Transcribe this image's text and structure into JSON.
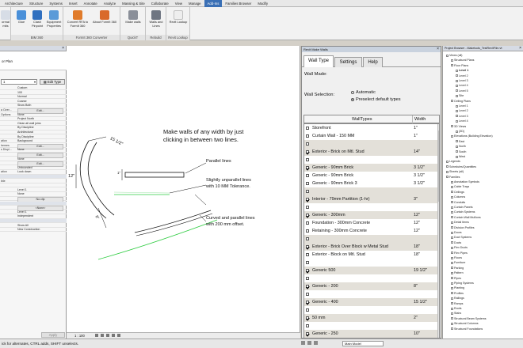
{
  "ribbon": {
    "tabs": [
      "Architecture",
      "Structure",
      "Systems",
      "Insert",
      "Annotate",
      "Analyze",
      "Massing & Site",
      "Collaborate",
      "View",
      "Manage",
      "Add-Ins",
      "Families Browser",
      "Modify"
    ],
    "active_tab": "Add-Ins",
    "groups": [
      {
        "label": "BIM 360",
        "buttons": [
          "Glue",
          "Clash Pinpoint",
          "Equipment Properties"
        ]
      },
      {
        "label": "FormIt 360 Converter",
        "buttons": [
          "Convert RFA to FormIt 360",
          "About FormIt 360"
        ]
      },
      {
        "label": "QuickT",
        "buttons": [
          "Make walls"
        ]
      },
      {
        "label": "Rebuild",
        "buttons": [
          "Walls and Lines"
        ]
      },
      {
        "label": "Revit Lookup",
        "buttons": [
          "Revit Lookup"
        ]
      }
    ],
    "first_button_partial": "ormal mits"
  },
  "properties": {
    "type_name": "or Plan",
    "selector_value": "1",
    "edit_type_label": "Edit Type",
    "rows": [
      {
        "k": "",
        "v": "Custom",
        "kind": "plain"
      },
      {
        "k": "",
        "v": "100",
        "kind": "plain"
      },
      {
        "k": "",
        "v": "Normal",
        "kind": "plain"
      },
      {
        "k": "",
        "v": "Coarse",
        "kind": "plain"
      },
      {
        "k": "",
        "v": "Show Both",
        "kind": "plain"
      },
      {
        "k": "a Over...",
        "v": "Edit...",
        "kind": "btn"
      },
      {
        "k": "Options",
        "v": "None",
        "kind": "plain"
      },
      {
        "k": "",
        "v": "Project North",
        "kind": "plain"
      },
      {
        "k": "",
        "v": "Clean all wall joins",
        "kind": "plain"
      },
      {
        "k": "",
        "v": "By Discipline",
        "kind": "plain"
      },
      {
        "k": "",
        "v": "Architectural",
        "kind": "plain"
      },
      {
        "k": "",
        "v": "By Discipline",
        "kind": "plain"
      },
      {
        "k": "ation",
        "v": "Background",
        "kind": "plain"
      },
      {
        "k": "hemes",
        "v": "Edit...",
        "kind": "btn"
      },
      {
        "k": "s Displ...",
        "v": "None",
        "kind": "plain"
      },
      {
        "k": "",
        "v": "Edit...",
        "kind": "btn"
      },
      {
        "k": "",
        "v": "None",
        "kind": "plain"
      },
      {
        "k": "",
        "v": "Edit...",
        "kind": "btn"
      },
      {
        "k": "",
        "v": "Unbounded",
        "kind": "plain"
      },
      {
        "k": "ation",
        "v": "Look down",
        "kind": "plain"
      },
      {
        "k": "",
        "v": "",
        "kind": "sec"
      },
      {
        "k": "ible",
        "v": "",
        "kind": "plain"
      },
      {
        "k": "",
        "v": "",
        "kind": "plain"
      },
      {
        "k": "",
        "v": "Level 1",
        "kind": "plain"
      },
      {
        "k": "",
        "v": "None",
        "kind": "plain"
      },
      {
        "k": "",
        "v": "No clip",
        "kind": "btn"
      },
      {
        "k": "",
        "v": "",
        "kind": "sec"
      },
      {
        "k": "",
        "v": "<None>",
        "kind": "btn"
      },
      {
        "k": "",
        "v": "Level 1",
        "kind": "plain"
      },
      {
        "k": "",
        "v": "Independent",
        "kind": "plain"
      },
      {
        "k": "",
        "v": "",
        "kind": "sec"
      },
      {
        "k": "",
        "v": "Show All",
        "kind": "plain"
      },
      {
        "k": "",
        "v": "New Construction",
        "kind": "plain"
      }
    ],
    "apply_label": "Apply"
  },
  "canvas": {
    "main_note_line1": "Make walls of any width by just",
    "main_note_line2": "clicking in between two lines.",
    "note_parallel": "Parallel lines",
    "note_unparallel_1": "Slightly unparallel lines",
    "note_unparallel_2": "with 10 MM Tolerance.",
    "note_curved_1": "Curved and parallel lines",
    "note_curved_2": "with 200 mm offset.",
    "dim_1": "15 1/2\"",
    "dim_2": "12\"",
    "dim_3": "8\"",
    "dim_4": "1\"",
    "scale": "1 : 100",
    "plan_model": "Main Model"
  },
  "dialog": {
    "title": "Revit Make Walls",
    "tabs": [
      "Wall Type",
      "Settings",
      "Help"
    ],
    "active_tab": "Wall Type",
    "wall_made_label": "Wall Made:",
    "wall_selection_label": "Wall Selection:",
    "radio_automatic": "Automatic",
    "radio_preselect": "Preselect default types",
    "col_name": "WallTypes",
    "col_width": "Width",
    "rows": [
      {
        "name": "Storefront",
        "width": "1\"",
        "checked": false,
        "band": false
      },
      {
        "name": "Curtain Wall - 150 MM",
        "width": "1\"",
        "checked": false,
        "band": false
      },
      {
        "name": "",
        "width": "",
        "checked": false,
        "band": true
      },
      {
        "name": "Exterior - Brick on Mtl. Stud",
        "width": "14\"",
        "checked": true,
        "band": true
      },
      {
        "name": "",
        "width": "",
        "checked": false,
        "band": false
      },
      {
        "name": "Generic - 90mm Brick",
        "width": "3 1/2\"",
        "checked": true,
        "band": true
      },
      {
        "name": "Generic - 90mm Brick",
        "width": "3 1/2\"",
        "checked": false,
        "band": false
      },
      {
        "name": "Generic - 90mm Brick 3",
        "width": "3 1/2\"",
        "checked": false,
        "band": false
      },
      {
        "name": "",
        "width": "",
        "checked": false,
        "band": true
      },
      {
        "name": "Interior - 79mm Partition (1-hr)",
        "width": "3\"",
        "checked": true,
        "band": true
      },
      {
        "name": "",
        "width": "",
        "checked": false,
        "band": false
      },
      {
        "name": "Generic - 300mm",
        "width": "12\"",
        "checked": true,
        "band": true
      },
      {
        "name": "Foundation - 300mm Concrete",
        "width": "12\"",
        "checked": false,
        "band": false
      },
      {
        "name": "Retaining - 300mm Concrete",
        "width": "12\"",
        "checked": false,
        "band": false
      },
      {
        "name": "",
        "width": "",
        "checked": false,
        "band": true
      },
      {
        "name": "Exterior - Brick Over Block w Metal Stud",
        "width": "18\"",
        "checked": true,
        "band": true
      },
      {
        "name": "Exterior - Block on Mtl. Stud",
        "width": "18\"",
        "checked": false,
        "band": false
      },
      {
        "name": "",
        "width": "",
        "checked": false,
        "band": false
      },
      {
        "name": "Generic 500",
        "width": "19 1/2\"",
        "checked": true,
        "band": true
      },
      {
        "name": "",
        "width": "",
        "checked": false,
        "band": false
      },
      {
        "name": "Generic - 200",
        "width": "8\"",
        "checked": true,
        "band": true
      },
      {
        "name": "",
        "width": "",
        "checked": false,
        "band": false
      },
      {
        "name": "Generic - 400",
        "width": "15 1/2\"",
        "checked": true,
        "band": true
      },
      {
        "name": "",
        "width": "",
        "checked": false,
        "band": false
      },
      {
        "name": "50 mm",
        "width": "2\"",
        "checked": true,
        "band": true
      },
      {
        "name": "",
        "width": "",
        "checked": false,
        "band": false
      },
      {
        "name": "Generic - 250",
        "width": "10\"",
        "checked": true,
        "band": true
      }
    ]
  },
  "browser": {
    "title": "Project Browser - Maketools_TestRevitFile.rvt",
    "nodes": [
      {
        "t": "Views (all)",
        "d": 0
      },
      {
        "t": "Structural Plans",
        "d": 1
      },
      {
        "t": "Floor Plans",
        "d": 1
      },
      {
        "t": "Level 1",
        "d": 2,
        "bold": true
      },
      {
        "t": "Level 2",
        "d": 2
      },
      {
        "t": "Level 3",
        "d": 2
      },
      {
        "t": "Level 4",
        "d": 2
      },
      {
        "t": "Level 5",
        "d": 2
      },
      {
        "t": "Site",
        "d": 2
      },
      {
        "t": "Ceiling Plans",
        "d": 1
      },
      {
        "t": "Level 1",
        "d": 2
      },
      {
        "t": "Level 2",
        "d": 2
      },
      {
        "t": "Level 3",
        "d": 2
      },
      {
        "t": "Level 4",
        "d": 2
      },
      {
        "t": "3D Views",
        "d": 1
      },
      {
        "t": "{3D}",
        "d": 2
      },
      {
        "t": "Elevations (Building Elevation)",
        "d": 1
      },
      {
        "t": "East",
        "d": 2
      },
      {
        "t": "North",
        "d": 2
      },
      {
        "t": "South",
        "d": 2
      },
      {
        "t": "West",
        "d": 2
      },
      {
        "t": "Legends",
        "d": 0
      },
      {
        "t": "Schedules/Quantities",
        "d": 0
      },
      {
        "t": "Sheets (all)",
        "d": 0
      },
      {
        "t": "Families",
        "d": 0
      },
      {
        "t": "Annotation Symbols",
        "d": 1
      },
      {
        "t": "Cable Trays",
        "d": 1
      },
      {
        "t": "Ceilings",
        "d": 1
      },
      {
        "t": "Columns",
        "d": 1
      },
      {
        "t": "Conduits",
        "d": 1
      },
      {
        "t": "Curtain Panels",
        "d": 1
      },
      {
        "t": "Curtain Systems",
        "d": 1
      },
      {
        "t": "Curtain Wall Mullions",
        "d": 1
      },
      {
        "t": "Detail Items",
        "d": 1
      },
      {
        "t": "Division Profiles",
        "d": 1
      },
      {
        "t": "Doors",
        "d": 1
      },
      {
        "t": "Duct Systems",
        "d": 1
      },
      {
        "t": "Ducts",
        "d": 1
      },
      {
        "t": "Flex Ducts",
        "d": 1
      },
      {
        "t": "Flex Pipes",
        "d": 1
      },
      {
        "t": "Floors",
        "d": 1
      },
      {
        "t": "Furniture",
        "d": 1
      },
      {
        "t": "Parking",
        "d": 1
      },
      {
        "t": "Pattern",
        "d": 1
      },
      {
        "t": "Pipes",
        "d": 1
      },
      {
        "t": "Piping Systems",
        "d": 1
      },
      {
        "t": "Planting",
        "d": 1
      },
      {
        "t": "Profiles",
        "d": 1
      },
      {
        "t": "Railings",
        "d": 1
      },
      {
        "t": "Ramps",
        "d": 1
      },
      {
        "t": "Roofs",
        "d": 1
      },
      {
        "t": "Stairs",
        "d": 1
      },
      {
        "t": "Structural Beam Systems",
        "d": 1
      },
      {
        "t": "Structural Columns",
        "d": 1
      },
      {
        "t": "Structural Foundations",
        "d": 1
      }
    ]
  },
  "status": {
    "hint": "ick for alternates, CTRL adds, SHIFT unselects."
  },
  "colors": {
    "active_tab": "#3a6fb5",
    "annotation_green": "#2ecc40",
    "band": "#e3e0d9"
  }
}
